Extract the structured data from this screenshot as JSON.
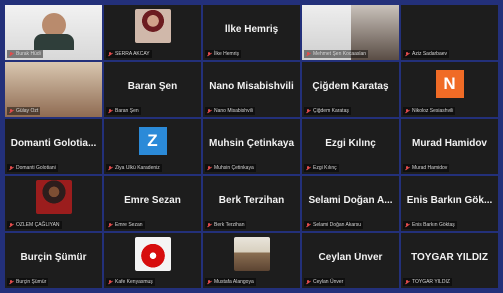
{
  "participants": [
    {
      "display_name": "",
      "label": "Burak Hüdi",
      "style": "video-person",
      "active": true
    },
    {
      "display_name": "",
      "label": "SERRA AKCAY",
      "style": "image-woman"
    },
    {
      "display_name": "İlke Hemriş",
      "label": "İlke Hemriş",
      "style": "text"
    },
    {
      "display_name": "",
      "label": "Mehmet Şen Kocaaslan",
      "style": "split-video"
    },
    {
      "display_name": "",
      "label": "Aziz Sadarbaev",
      "style": "blank"
    },
    {
      "display_name": "",
      "label": "Gülay Ozt",
      "style": "video-bright"
    },
    {
      "display_name": "Baran Şen",
      "label": "Baran Şen",
      "style": "text"
    },
    {
      "display_name": "Nano Misabishvili",
      "label": "Nano Misabishvili",
      "style": "text"
    },
    {
      "display_name": "Çiğdem Karataş",
      "label": "Çiğdem Karataş",
      "style": "text"
    },
    {
      "display_name": "",
      "label": "Nikoloz Sesiashvili",
      "style": "avatar",
      "avatar_letter": "N",
      "avatar_color": "#f06b26"
    },
    {
      "display_name": "Domanti Golotia...",
      "label": "Domanti Golotiani",
      "style": "text"
    },
    {
      "display_name": "",
      "label": "Ziya Ulkü Karadeniz",
      "style": "avatar",
      "avatar_letter": "Z",
      "avatar_color": "#2b8ad8"
    },
    {
      "display_name": "Muhsin Çetinkaya",
      "label": "Muhsin Çetinkaya",
      "style": "text"
    },
    {
      "display_name": "Ezgi Kılınç",
      "label": "Ezgi Kılınç",
      "style": "text"
    },
    {
      "display_name": "Murad Hamidov",
      "label": "Murad Hamidov",
      "style": "text"
    },
    {
      "display_name": "",
      "label": "OZLEM ÇAĞLIYAN",
      "style": "image-man"
    },
    {
      "display_name": "Emre Sezan",
      "label": "Emre Sezan",
      "style": "text"
    },
    {
      "display_name": "Berk Terzihan",
      "label": "Berk Terzihan",
      "style": "text"
    },
    {
      "display_name": "Selami Doğan A...",
      "label": "Selami Doğan Akarsu",
      "style": "text"
    },
    {
      "display_name": "Enis Barkın Gök...",
      "label": "Enis Barkın Göktaş",
      "style": "text"
    },
    {
      "display_name": "Burçin Şümür",
      "label": "Burçin Şümür",
      "style": "text"
    },
    {
      "display_name": "",
      "label": "Kafe Kenyasmuş",
      "style": "image-lips"
    },
    {
      "display_name": "",
      "label": "Mustafa Alangoya",
      "style": "image-eagle"
    },
    {
      "display_name": "Ceylan Ünver",
      "label": "Ceylan Ünver",
      "style": "text"
    },
    {
      "display_name": "TOYGAR YILDIZ",
      "label": "TOYGAR YILDIZ",
      "style": "text"
    }
  ],
  "colors": {
    "frame": "#23307a",
    "tile": "#1d1d1d",
    "active_border": "#e8d43a",
    "muted_mic": "#e34b4b"
  }
}
